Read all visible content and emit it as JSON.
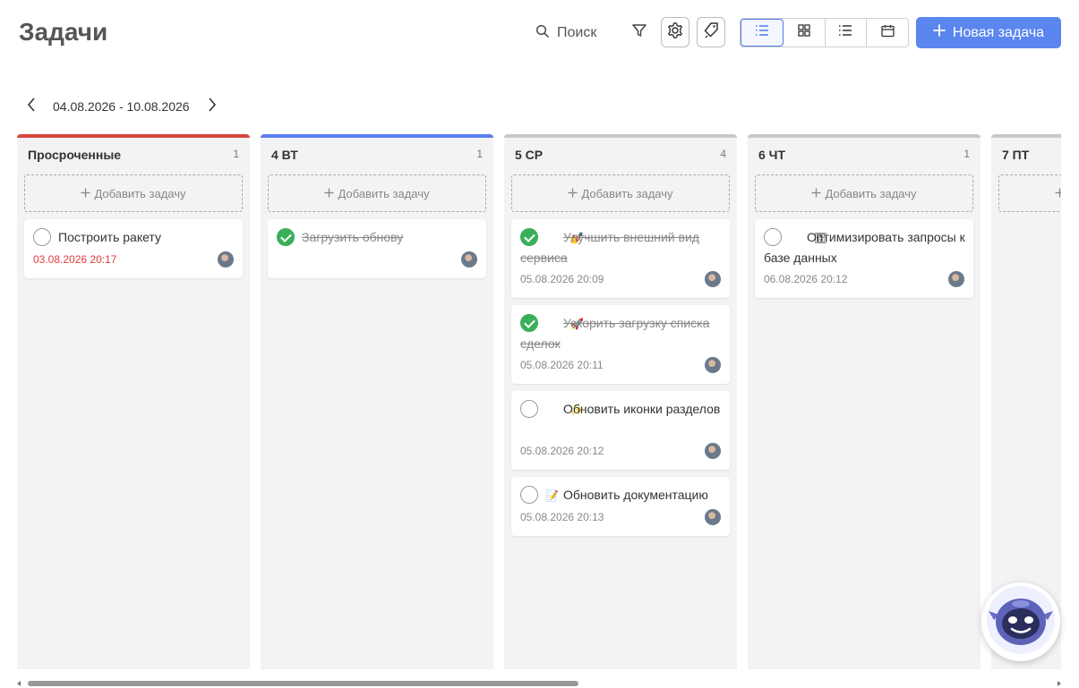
{
  "header": {
    "title": "Задачи",
    "search_label": "Поиск",
    "new_task_label": "Новая задача"
  },
  "icons": {
    "search": "search-icon",
    "filter": "filter-icon",
    "settings": "gear-icon",
    "tags": "tag-icon",
    "view_list": "list-icon",
    "view_grid": "grid-icon",
    "view_list2": "bullet-list-icon",
    "view_calendar": "calendar-icon",
    "plus": "plus-icon"
  },
  "colors": {
    "accent": "#5b86f0",
    "overdue": "#e23d3d",
    "done": "#3aaf5a",
    "column_bg": "#f3f3f5"
  },
  "date_nav": {
    "range": "04.08.2026 - 10.08.2026"
  },
  "add_task_label": "Добавить задачу",
  "columns": [
    {
      "title": "Просроченные",
      "count": "1",
      "bar_color": "#d9453d",
      "cards": [
        {
          "title": "Построить ракету",
          "emoji": "",
          "date": "03.08.2026 20:17",
          "done": false,
          "overdue": true
        }
      ]
    },
    {
      "title": "4 ВТ",
      "count": "1",
      "bar_color": "#5b7ef0",
      "cards": [
        {
          "title": "Загрузить обнову",
          "emoji": "",
          "date": "",
          "done": true,
          "overdue": false
        }
      ]
    },
    {
      "title": "5 СР",
      "count": "4",
      "bar_color": "#c8c8c8",
      "cards": [
        {
          "title": "Улучшить внешний вид сервиса",
          "emoji": "💅",
          "date": "05.08.2026 20:09",
          "done": true,
          "overdue": false
        },
        {
          "title": "Ускорить загрузку списка сделок",
          "emoji": "🚀",
          "date": "05.08.2026 20:11",
          "done": true,
          "overdue": false
        },
        {
          "title": "Обновить иконки разделов",
          "emoji": "✨",
          "date": "05.08.2026 20:12",
          "done": false,
          "overdue": false
        },
        {
          "title": "Обновить документацию",
          "emoji": "📝",
          "date": "05.08.2026 20:13",
          "done": false,
          "overdue": false
        }
      ]
    },
    {
      "title": "6 ЧТ",
      "count": "1",
      "bar_color": "#c8c8c8",
      "cards": [
        {
          "title": "Оптимизировать запросы к базе данных",
          "emoji": "🗄",
          "date": "06.08.2026 20:12",
          "done": false,
          "overdue": false
        }
      ]
    },
    {
      "title": "7 ПТ",
      "count": "",
      "bar_color": "#c8c8c8",
      "cards": []
    }
  ]
}
